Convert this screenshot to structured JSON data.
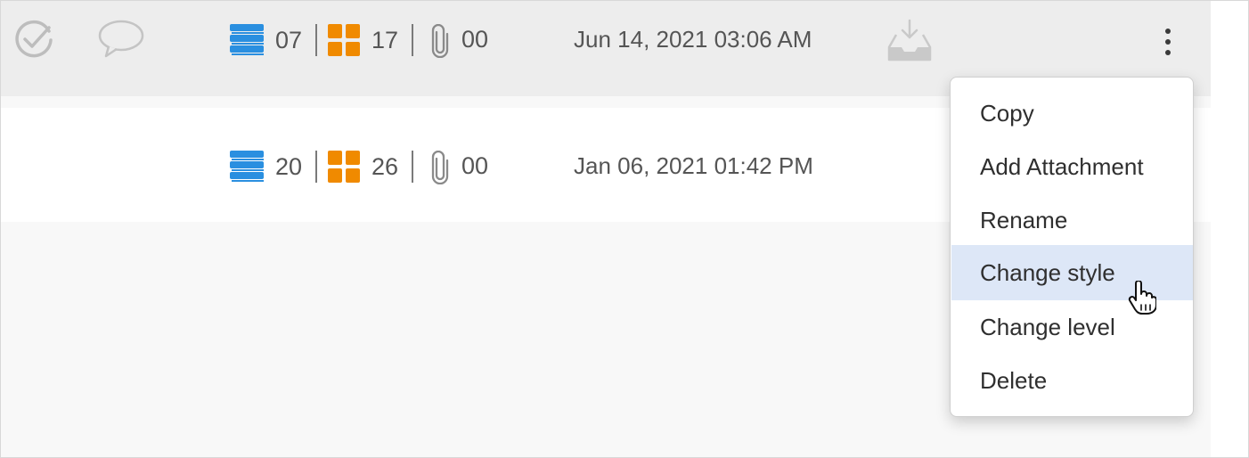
{
  "rows": [
    {
      "stacks_count": "07",
      "grid_count": "17",
      "attachments_count": "00",
      "date": "Jun 14, 2021 03:06 AM",
      "selected": true
    },
    {
      "stacks_count": "20",
      "grid_count": "26",
      "attachments_count": "00",
      "date": "Jan 06, 2021 01:42 PM",
      "selected": false
    }
  ],
  "context_menu": {
    "items": [
      {
        "label": "Copy"
      },
      {
        "label": "Add Attachment"
      },
      {
        "label": "Rename"
      },
      {
        "label": "Change style",
        "hovered": true
      },
      {
        "label": "Change level"
      },
      {
        "label": "Delete"
      }
    ]
  },
  "icons": {
    "complete": "check-circle-icon",
    "comment": "speech-bubble-icon",
    "stack": "layers-icon",
    "grid": "grid-icon",
    "attachment": "paperclip-icon",
    "download": "inbox-download-icon",
    "more": "kebab-menu-icon",
    "cursor": "hand-pointer-icon"
  },
  "colors": {
    "stack_blue": "#2a8fe0",
    "grid_orange": "#f08a00",
    "menu_hover": "#dde7f7",
    "selected_row": "#ededed"
  }
}
